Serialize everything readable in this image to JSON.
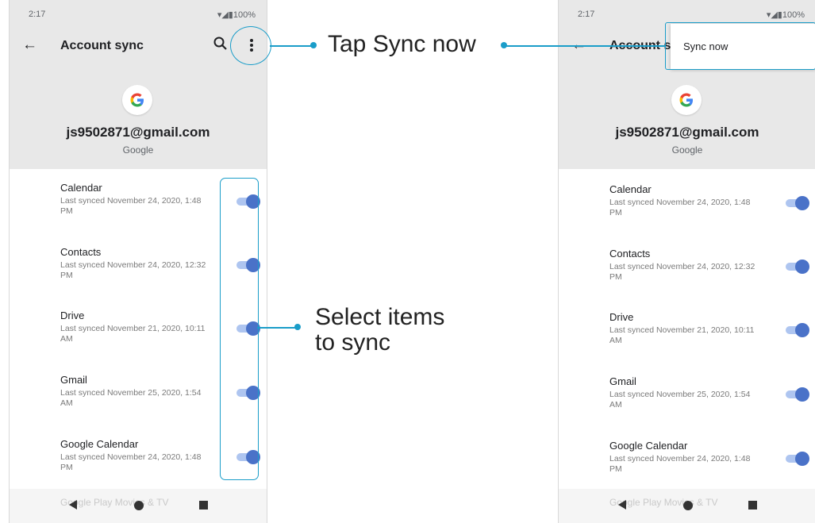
{
  "left_screen": {
    "status": {
      "time": "2:17",
      "icons": "▾◢▮100%"
    },
    "app_bar": {
      "title": "Account sync",
      "back_icon": "back-arrow-icon",
      "search_icon": "search-icon",
      "more_icon": "more-vert-icon"
    },
    "account": {
      "email": "js9502871@gmail.com",
      "provider": "Google"
    },
    "items": [
      {
        "title": "Calendar",
        "subtitle": "Last synced November 24, 2020, 1:48 PM",
        "enabled": true
      },
      {
        "title": "Contacts",
        "subtitle": "Last synced November 24, 2020, 12:32 PM",
        "enabled": true
      },
      {
        "title": "Drive",
        "subtitle": "Last synced November 21, 2020, 10:11 AM",
        "enabled": true
      },
      {
        "title": "Gmail",
        "subtitle": "Last synced November 25, 2020, 1:54 AM",
        "enabled": true
      },
      {
        "title": "Google Calendar",
        "subtitle": "Last synced November 24, 2020, 1:48 PM",
        "enabled": true
      }
    ],
    "partial_item": "Google Play Movies & TV"
  },
  "right_screen": {
    "status": {
      "time": "2:17",
      "icons": "▾◢▮100%"
    },
    "app_bar": {
      "title": "Account s"
    },
    "menu": {
      "item": "Sync now"
    },
    "account": {
      "email": "js9502871@gmail.com",
      "provider": "Google"
    },
    "items": [
      {
        "title": "Calendar",
        "subtitle": "Last synced November 24, 2020, 1:48 PM",
        "enabled": true
      },
      {
        "title": "Contacts",
        "subtitle": "Last synced November 24, 2020, 12:32 PM",
        "enabled": true
      },
      {
        "title": "Drive",
        "subtitle": "Last synced November 21, 2020, 10:11 AM",
        "enabled": true
      },
      {
        "title": "Gmail",
        "subtitle": "Last synced November 25, 2020, 1:54 AM",
        "enabled": true
      },
      {
        "title": "Google Calendar",
        "subtitle": "Last synced November 24, 2020, 1:48 PM",
        "enabled": true
      }
    ],
    "partial_item": "Google Play Movies & TV"
  },
  "annotations": {
    "tap_sync_now": "Tap Sync now",
    "select_line1": "Select items",
    "select_line2": "to sync"
  },
  "colors": {
    "accent": "#1a9dc9",
    "toggle_on": "#4a72c8",
    "toggle_track": "#aec5f0",
    "header_bg": "#e8e8e8"
  }
}
